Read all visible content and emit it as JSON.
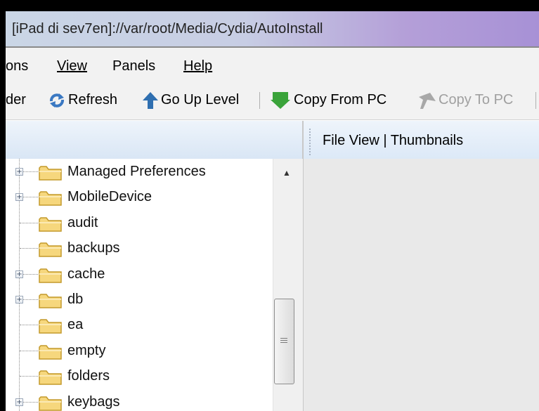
{
  "window": {
    "title": "[iPad di sev7en]://var/root/Media/Cydia/AutoInstall"
  },
  "menu": {
    "items": [
      {
        "label": "ons",
        "name": "menu-options"
      },
      {
        "label": "View",
        "name": "menu-view"
      },
      {
        "label": "Panels",
        "name": "menu-panels"
      },
      {
        "label": "Help",
        "name": "menu-help"
      }
    ]
  },
  "toolbar": {
    "folder_label": "der",
    "refresh_label": "Refresh",
    "go_up_label": "Go Up Level",
    "copy_from_label": "Copy From PC",
    "copy_to_label": "Copy To PC",
    "icons": {
      "refresh": "refresh-icon",
      "go_up": "arrow-up-icon",
      "copy_from": "arrow-down-green-icon",
      "copy_to": "arrow-up-gray-icon"
    }
  },
  "right_panel": {
    "tabs_text": "File View  |  Thumbnails"
  },
  "tree": {
    "items": [
      {
        "label": "Managed Preferences",
        "expandable": true
      },
      {
        "label": "MobileDevice",
        "expandable": true
      },
      {
        "label": "audit",
        "expandable": false
      },
      {
        "label": "backups",
        "expandable": false
      },
      {
        "label": "cache",
        "expandable": true
      },
      {
        "label": "db",
        "expandable": true
      },
      {
        "label": "ea",
        "expandable": false
      },
      {
        "label": "empty",
        "expandable": false
      },
      {
        "label": "folders",
        "expandable": false
      },
      {
        "label": "keybags",
        "expandable": true
      }
    ]
  },
  "colors": {
    "folder_fill": "#f6d77d",
    "folder_stroke": "#c49a2c",
    "go_up_arrow": "#2f6fb0",
    "copy_from_arrow": "#3aa33a",
    "disabled_text": "#a0a0a0"
  }
}
